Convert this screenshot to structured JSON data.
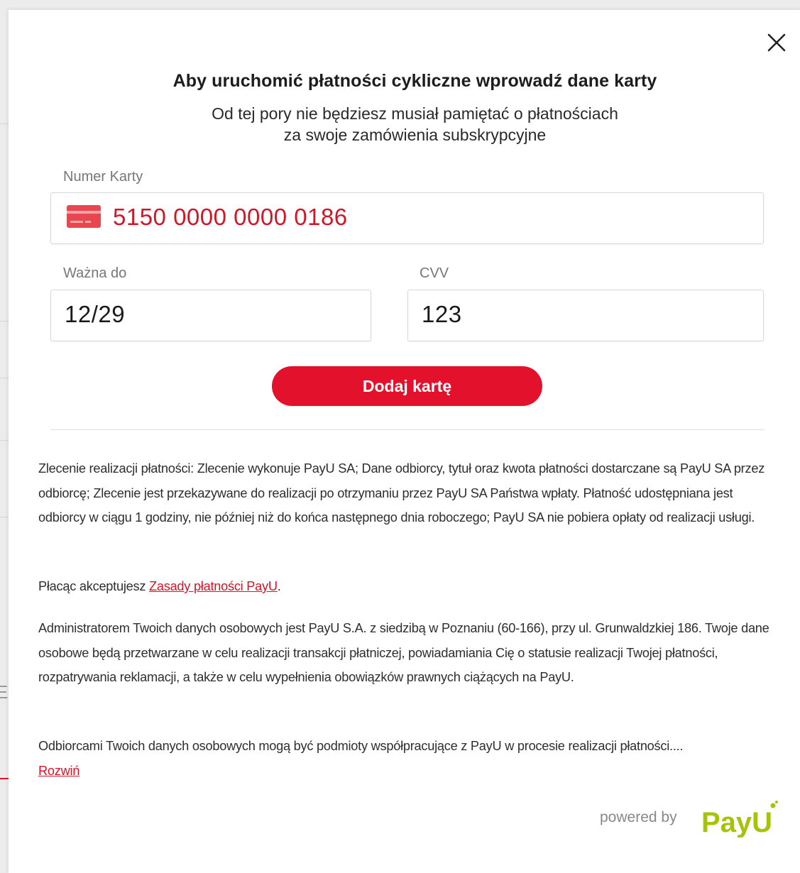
{
  "modal": {
    "title": "Aby uruchomić płatności cykliczne wprowadź dane karty",
    "subtitle_line1": "Od tej pory nie będziesz musiał pamiętać o płatnościach",
    "subtitle_line2": "za swoje zamówienia subskrypcyjne",
    "close_icon": "close-icon"
  },
  "form": {
    "card_number_label": "Numer Karty",
    "card_number_value": "5150 0000 0000 0186",
    "card_icon": "credit-card-icon",
    "expiry_label": "Ważna do",
    "expiry_value": "12/29",
    "cvv_label": "CVV",
    "cvv_value": "123",
    "submit_label": "Dodaj kartę"
  },
  "legal": {
    "paragraph1": "Zlecenie realizacji płatności: Zlecenie wykonuje PayU SA; Dane odbiorcy, tytuł oraz kwota płatności dostarczane są PayU SA przez odbiorcę; Zlecenie jest przekazywane do realizacji po otrzymaniu przez PayU SA Państwa wpłaty. Płatność udostępniana jest odbiorcy w ciągu 1 godziny, nie później niż do końca następnego dnia roboczego; PayU SA nie pobiera opłaty od realizacji usługi.",
    "paragraph2_prefix": "Płacąc akceptujesz ",
    "paragraph2_link": "Zasady płatności PayU",
    "paragraph2_suffix": ".",
    "paragraph3": "Administratorem Twoich danych osobowych jest PayU S.A. z siedzibą w Poznaniu (60-166), przy ul. Grunwaldzkiej 186. Twoje dane osobowe będą przetwarzane w celu realizacji transakcji płatniczej, powiadamiania Cię o statusie realizacji Twojej płatności, rozpatrywania reklamacji, a także w celu wypełnienia obowiązków prawnych ciążących na PayU.",
    "paragraph4": "Odbiorcami Twoich danych osobowych mogą być podmioty współpracujące z PayU w procesie realizacji płatności....",
    "expand_link": "Rozwiń"
  },
  "footer": {
    "powered_by": "powered by",
    "brand": "PayU",
    "brand_color": "#a6c307"
  },
  "colors": {
    "accent": "#e4112c",
    "card_number_text": "#d41528",
    "label": "#777777"
  }
}
